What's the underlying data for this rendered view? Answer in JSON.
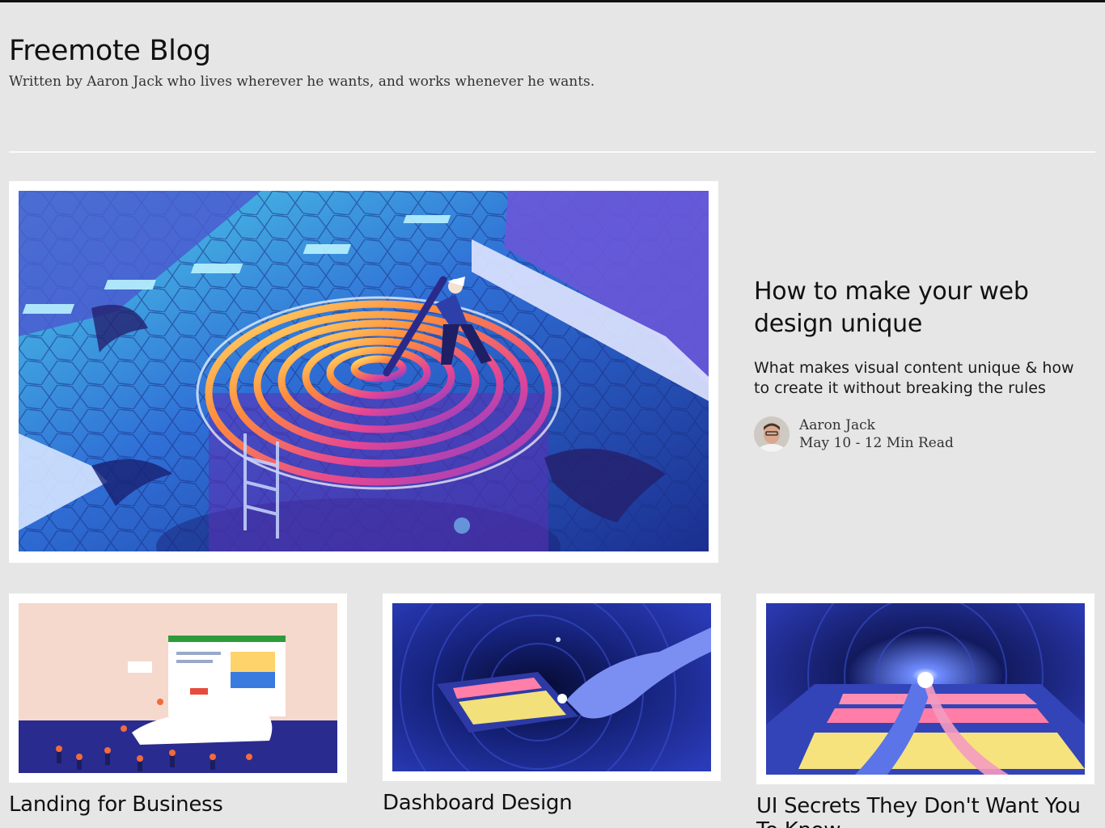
{
  "header": {
    "title": "Freemote Blog",
    "subtitle": "Written by Aaron Jack who lives wherever he wants, and works whenever he wants."
  },
  "featured": {
    "title": "How to make your web design unique",
    "excerpt": "What makes visual content unique & how to create it without breaking the rules",
    "author": "Aaron Jack",
    "meta": "May 10 - 12 Min Read"
  },
  "posts": [
    {
      "title": "Landing for Business"
    },
    {
      "title": "Dashboard Design"
    },
    {
      "title": "UI Secrets They Don't Want You To Know"
    }
  ]
}
